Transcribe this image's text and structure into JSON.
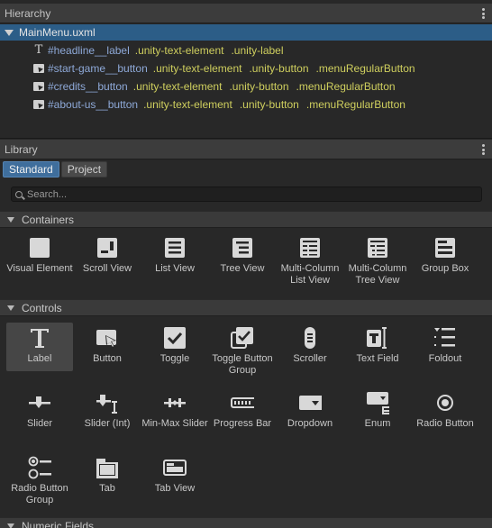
{
  "hierarchy": {
    "title": "Hierarchy",
    "root": "MainMenu.uxml",
    "items": [
      {
        "type": "label",
        "name": "#headline__label",
        "classes": [
          ".unity-text-element",
          ".unity-label"
        ]
      },
      {
        "type": "button",
        "name": "#start-game__button",
        "classes": [
          ".unity-text-element",
          ".unity-button",
          ".menuRegularButton"
        ]
      },
      {
        "type": "button",
        "name": "#credits__button",
        "classes": [
          ".unity-text-element",
          ".unity-button",
          ".menuRegularButton"
        ]
      },
      {
        "type": "button",
        "name": "#about-us__button",
        "classes": [
          ".unity-text-element",
          ".unity-button",
          ".menuRegularButton"
        ]
      }
    ]
  },
  "library": {
    "title": "Library",
    "tabs": [
      {
        "label": "Standard",
        "active": true
      },
      {
        "label": "Project",
        "active": false
      }
    ],
    "search_placeholder": "Search...",
    "categories": [
      {
        "label": "Containers"
      },
      {
        "label": "Controls"
      },
      {
        "label": "Numeric Fields"
      }
    ],
    "containers": [
      {
        "label": "Visual Element",
        "icon": "visual-element-icon"
      },
      {
        "label": "Scroll View",
        "icon": "scroll-view-icon"
      },
      {
        "label": "List View",
        "icon": "list-view-icon"
      },
      {
        "label": "Tree View",
        "icon": "tree-view-icon"
      },
      {
        "label": "Multi-Column List View",
        "icon": "multi-column-list-view-icon"
      },
      {
        "label": "Multi-Column Tree View",
        "icon": "multi-column-tree-view-icon"
      },
      {
        "label": "Group Box",
        "icon": "group-box-icon"
      }
    ],
    "controls": [
      {
        "label": "Label",
        "icon": "label-icon"
      },
      {
        "label": "Button",
        "icon": "button-icon"
      },
      {
        "label": "Toggle",
        "icon": "toggle-icon"
      },
      {
        "label": "Toggle Button Group",
        "icon": "toggle-button-group-icon"
      },
      {
        "label": "Scroller",
        "icon": "scroller-icon"
      },
      {
        "label": "Text Field",
        "icon": "text-field-icon"
      },
      {
        "label": "Foldout",
        "icon": "foldout-icon"
      },
      {
        "label": "Slider",
        "icon": "slider-icon"
      },
      {
        "label": "Slider (Int)",
        "icon": "slider-int-icon"
      },
      {
        "label": "Min-Max Slider",
        "icon": "min-max-slider-icon"
      },
      {
        "label": "Progress Bar",
        "icon": "progress-bar-icon"
      },
      {
        "label": "Dropdown",
        "icon": "dropdown-icon"
      },
      {
        "label": "Enum",
        "icon": "enum-icon"
      },
      {
        "label": "Radio Button",
        "icon": "radio-button-icon"
      },
      {
        "label": "Radio Button Group",
        "icon": "radio-button-group-icon"
      },
      {
        "label": "Tab",
        "icon": "tab-icon"
      },
      {
        "label": "Tab View",
        "icon": "tab-view-icon"
      }
    ]
  }
}
